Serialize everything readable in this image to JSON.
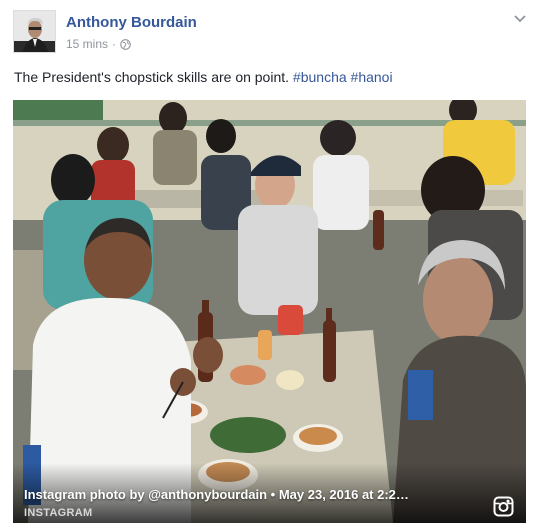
{
  "post": {
    "author": "Anthony Bourdain",
    "timestamp": "15 mins",
    "separator": "·",
    "privacy_icon": "globe-icon",
    "menu_icon": "chevron-down-icon",
    "text_main": "The President's chopstick skills are on point. ",
    "hashtags": [
      "#buncha",
      "#hanoi"
    ]
  },
  "photo": {
    "caption": "Instagram photo by @anthonybourdain • May 23, 2016 at 2:2…",
    "source": "INSTAGRAM",
    "source_icon": "instagram-icon"
  },
  "colors": {
    "link": "#365899",
    "text": "#1d2129",
    "meta": "#90949c"
  }
}
